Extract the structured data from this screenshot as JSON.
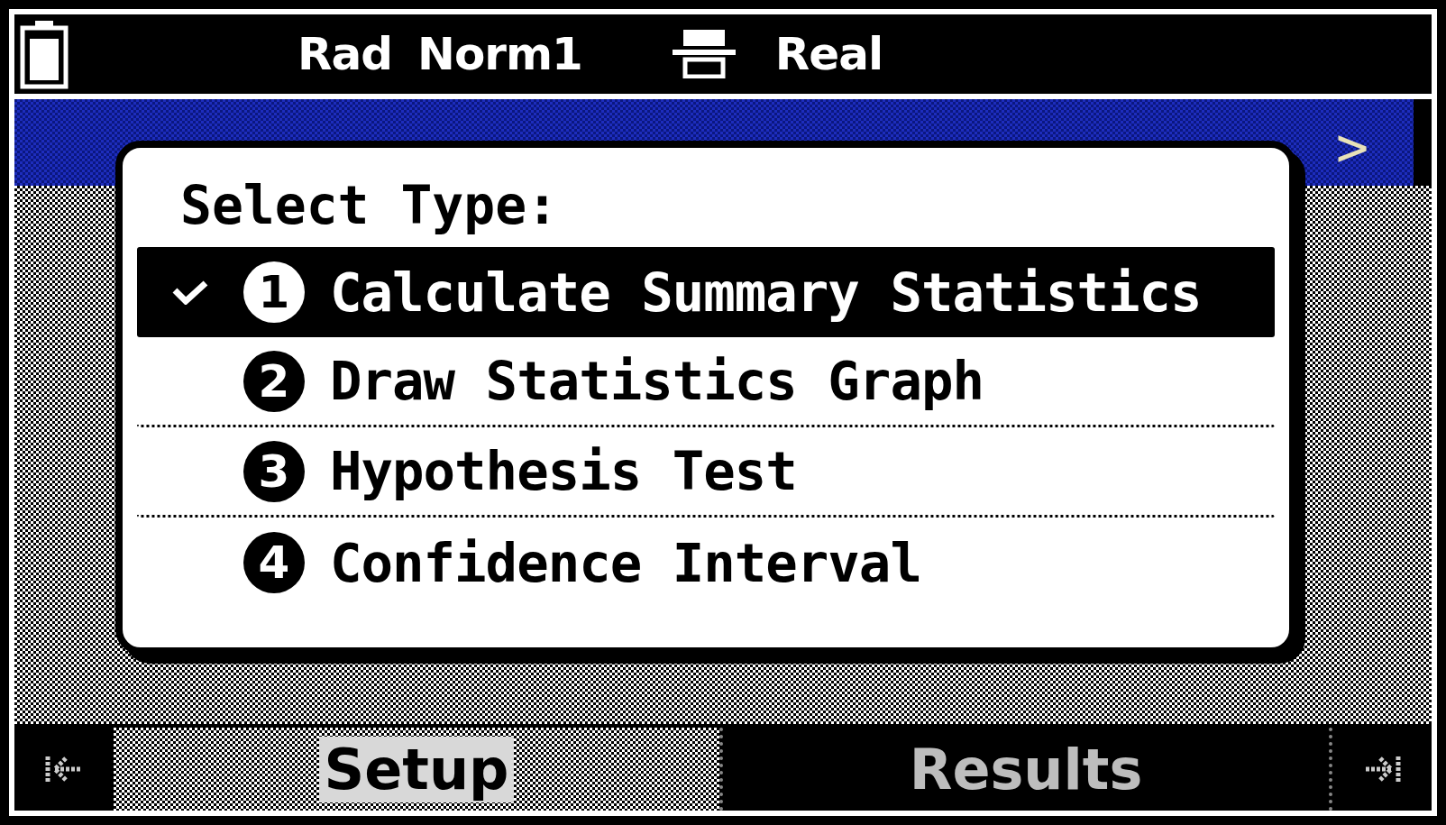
{
  "status_bar": {
    "angle_mode": "Rad",
    "display_mode": "Norm1",
    "complex_mode": "Real"
  },
  "title_bar": {
    "arrow": ">"
  },
  "dialog": {
    "title": "Select Type:",
    "items": [
      {
        "number": "1",
        "label": "Calculate Summary Statistics",
        "selected": true
      },
      {
        "number": "2",
        "label": "Draw Statistics Graph",
        "selected": false
      },
      {
        "number": "3",
        "label": "Hypothesis Test",
        "selected": false
      },
      {
        "number": "4",
        "label": "Confidence Interval",
        "selected": false
      }
    ]
  },
  "tabs": [
    {
      "label": "Setup",
      "selected": true
    },
    {
      "label": "Results",
      "selected": false
    }
  ]
}
